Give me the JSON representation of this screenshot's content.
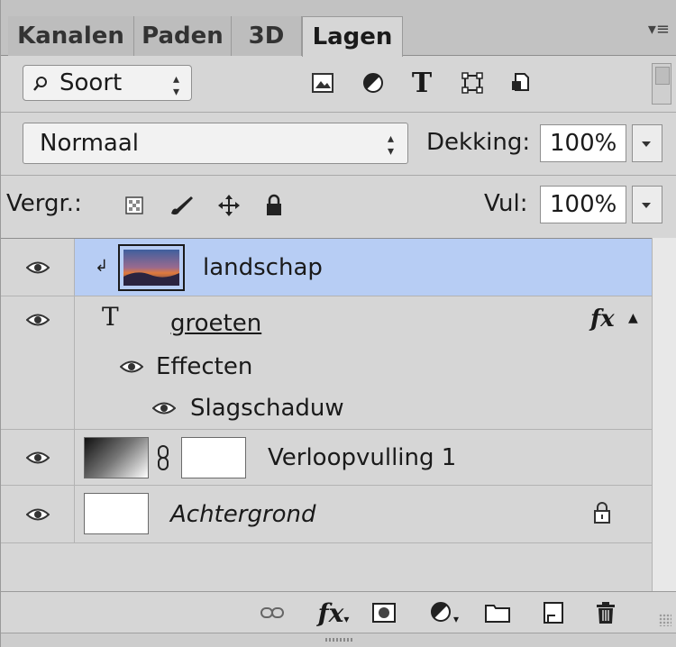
{
  "tabs": [
    {
      "label": "Kanalen",
      "active": false
    },
    {
      "label": "Paden",
      "active": false
    },
    {
      "label": "3D",
      "active": false
    },
    {
      "label": "Lagen",
      "active": true
    }
  ],
  "filter": {
    "kind_label": "Soort",
    "icons": [
      "image-filter-icon",
      "adjustment-filter-icon",
      "type-filter-icon",
      "shape-filter-icon",
      "smart-object-filter-icon"
    ]
  },
  "blend": {
    "mode": "Normaal",
    "opacity_label": "Dekking:",
    "opacity_value": "100%"
  },
  "lock": {
    "label": "Vergr.:",
    "icons": [
      "lock-transparent-icon",
      "lock-image-icon",
      "lock-position-icon",
      "lock-all-icon"
    ],
    "fill_label": "Vul:",
    "fill_value": "100%"
  },
  "layers": [
    {
      "name": "landschap",
      "type": "image",
      "selected": true,
      "clipped": true
    },
    {
      "name": "groeten",
      "type": "text",
      "fx": "fx",
      "effects_label": "Effecten",
      "effect_items": [
        "Slagschaduw"
      ]
    },
    {
      "name": "Verloopvulling 1",
      "type": "gradient-fill"
    },
    {
      "name": "Achtergrond",
      "type": "background",
      "locked": true
    }
  ],
  "bottom_icons": [
    "link-layers-icon",
    "layer-style-icon",
    "layer-mask-icon",
    "adjustment-layer-icon",
    "group-icon",
    "new-layer-icon",
    "delete-icon"
  ],
  "bottom_fx_label": "fx",
  "colors": {
    "panel_bg": "#d6d6d6",
    "selected_row": "#b7cdf4",
    "tab_bg": "#bdbdbd"
  }
}
